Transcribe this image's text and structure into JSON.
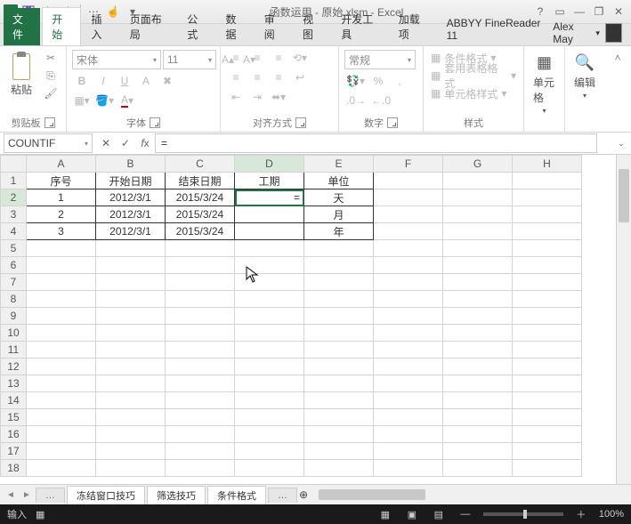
{
  "title": "函数运用 - 原始.xlsm - Excel",
  "qat": {
    "save": "保存",
    "undo": "撤销",
    "redo": "重做"
  },
  "tabs": {
    "file": "文件",
    "home": "开始",
    "insert": "插入",
    "layout": "页面布局",
    "formulas": "公式",
    "data": "数据",
    "review": "审阅",
    "view": "视图",
    "dev": "开发工具",
    "addins": "加载项",
    "abbyy": "ABBYY FineReader 11"
  },
  "user": {
    "name": "Alex May"
  },
  "ribbon": {
    "clipboard": {
      "paste": "粘贴",
      "label": "剪贴板"
    },
    "font": {
      "name": "宋体",
      "size": "11",
      "label": "字体"
    },
    "align": {
      "label": "对齐方式",
      "wrap": "自动换行",
      "merge": "合并后居中"
    },
    "number": {
      "format": "常规",
      "label": "数字"
    },
    "styles": {
      "cond": "条件格式",
      "table": "套用表格格式",
      "cell": "单元格样式",
      "label": "样式"
    },
    "cells": {
      "label": "单元格"
    },
    "editing": {
      "label": "编辑"
    }
  },
  "formula_bar": {
    "name_box": "COUNTIF",
    "fx": "="
  },
  "grid": {
    "cols": [
      "A",
      "B",
      "C",
      "D",
      "E",
      "F",
      "G",
      "H"
    ],
    "rows": [
      "1",
      "2",
      "3",
      "4",
      "5",
      "6",
      "7",
      "8",
      "9",
      "10",
      "11",
      "12",
      "13",
      "14",
      "15",
      "16",
      "17",
      "18"
    ],
    "active": "D2",
    "data": [
      {
        "A": "序号",
        "B": "开始日期",
        "C": "结束日期",
        "D": "工期",
        "E": "单位"
      },
      {
        "A": "1",
        "B": "2012/3/1",
        "C": "2015/3/24",
        "D": "=",
        "E": "天"
      },
      {
        "A": "2",
        "B": "2012/3/1",
        "C": "2015/3/24",
        "D": "",
        "E": "月"
      },
      {
        "A": "3",
        "B": "2012/3/1",
        "C": "2015/3/24",
        "D": "",
        "E": "年"
      }
    ]
  },
  "sheets": {
    "s1": "冻结窗口技巧",
    "s2": "筛选技巧",
    "s3": "条件格式"
  },
  "status": {
    "mode": "输入",
    "zoom": "100%"
  }
}
